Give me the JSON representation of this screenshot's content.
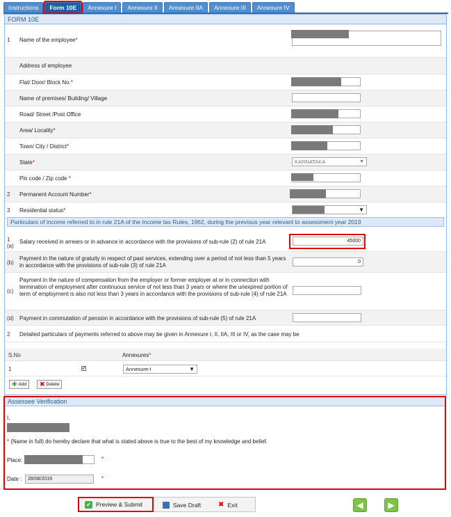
{
  "tabs": [
    {
      "label": "Instructions"
    },
    {
      "label": "Form 10E"
    },
    {
      "label": "Annexure I"
    },
    {
      "label": "Annexure II"
    },
    {
      "label": "Annexure IIA"
    },
    {
      "label": "Annexure III"
    },
    {
      "label": "Annexure IV"
    }
  ],
  "form_title": "FORM 10E",
  "employee": {
    "name_label": "Name of the employee",
    "address_label": "Address of employee",
    "flat_label": "Flat/ Door/ Block No.",
    "premises_label": "Name of premises/ Building/ Village",
    "road_label": "Road/ Street /Post Office",
    "area_label": "Area/ Locality",
    "town_label": "Town/ City / District",
    "state_label": "State",
    "state_value": "KARNATAKA",
    "pin_label": "Pin code / Zip code",
    "pan_label": "Permanent Account Number",
    "residential_label": "Residential status",
    "num1": "1",
    "num2": "2",
    "num3": "3"
  },
  "particulars": {
    "band": "Particulars of income referred to in rule 21A of the Income tax Rules, 1962, during the previous year relevant to assessment year 2019",
    "a_num": "1 (a)",
    "a_label": "Salary received in arrears or in advance in accordance with the provisions of sub-rule (2) of rule 21A",
    "a_value": "45000",
    "b_num": "(b)",
    "b_label": "Payment in the nature of gratuity in respect of past services, extending over a period of not less than 5 years in accordance with the provisions of sub-rule (3) of rule 21A",
    "b_value": "0",
    "c_num": "(c)",
    "c_label": "Payment in the nature of compensation from the employer or former employer at or in connection with termination of employment after continuous service of not less than 3 years or where the unexpired portion of term of employment is also not less than 3 years in accordance with the provisions of sub-rule (4) of rule 21A",
    "d_num": "(d)",
    "d_label": "Payment in commutation of pension in accordance with the provisions of sub-rule (5) of rule 21A",
    "two_num": "2",
    "two_label": "Detailed particulars of payments referred to above may be given in Annexure I, II, IIA, III or IV, as the case may be"
  },
  "annex_table": {
    "col_sno": "S.No",
    "col_annex": "Annexures",
    "row_sno": "1",
    "row_value": "Annexure-I",
    "add_label": "Add",
    "delete_label": "Delete"
  },
  "verification": {
    "title": "Assessee Verification",
    "i_label": "I,",
    "declaration": "(Name in full) do hereby declare that what is stated above is true to the best of my knowledge and belief.",
    "place_label": "Place:",
    "date_label": "Date :",
    "date_value": "28/08/2019"
  },
  "actions": {
    "preview": "Preview & Submit",
    "save": "Save Draft",
    "exit": "Exit"
  },
  "colors": {
    "accent": "#1f5fa5",
    "highlight": "#e00000",
    "nav": "#7ec24a"
  }
}
